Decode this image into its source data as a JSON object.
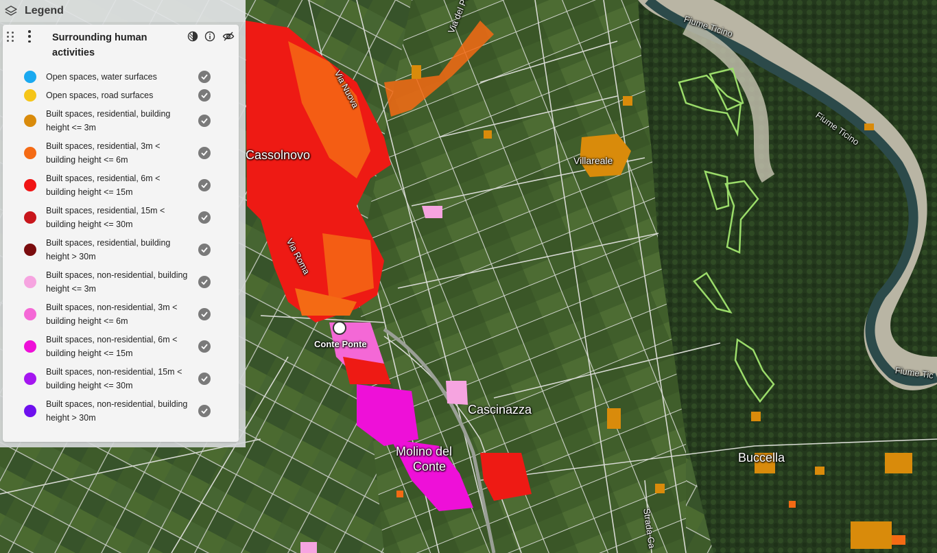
{
  "legend": {
    "header_title": "Legend",
    "layer_title": "Surrounding human activities",
    "items": [
      {
        "label": "Open spaces, water surfaces",
        "color": "#1aa9f0"
      },
      {
        "label": "Open spaces, road surfaces",
        "color": "#f5c518"
      },
      {
        "label": "Built spaces, residential, building height <= 3m",
        "color": "#d98b0b"
      },
      {
        "label": "Built spaces, residential, 3m < building height <= 6m",
        "color": "#f46a14"
      },
      {
        "label": "Built spaces, residential, 6m < building height <= 15m",
        "color": "#f01414"
      },
      {
        "label": "Built spaces, residential, 15m < building height <= 30m",
        "color": "#c8161c"
      },
      {
        "label": "Built spaces, residential, building height > 30m",
        "color": "#7a0c0e"
      },
      {
        "label": "Built spaces, non-residential, building height <= 3m",
        "color": "#f6a4e0"
      },
      {
        "label": "Built spaces, non-residential, 3m < building height <= 6m",
        "color": "#f468d6"
      },
      {
        "label": "Built spaces, non-residential, 6m < building height <= 15m",
        "color": "#ee10d8"
      },
      {
        "label": "Built spaces, non-residential, 15m < building height <= 30m",
        "color": "#a416f0"
      },
      {
        "label": "Built spaces, non-residential, building height > 30m",
        "color": "#6e10ee"
      }
    ]
  },
  "map": {
    "labels": {
      "cassolnovo": "Cassolnovo",
      "villareale": "Villareale",
      "conte_ponte": "Conte Ponte",
      "cascinazza": "Cascinazza",
      "molino_line1": "Molino del",
      "molino_line2": "Conte",
      "buccella": "Buccella",
      "via_del_porto": "Via del Porto",
      "via_nuova": "Via Nuova",
      "via_roma": "Via Roma",
      "strada": "Strada Ca",
      "fiume_ticino_1": "Fiume Ticino",
      "fiume_ticino_2": "Fiume Ticino",
      "fiume_ticino_3": "Fiume Tic"
    }
  }
}
